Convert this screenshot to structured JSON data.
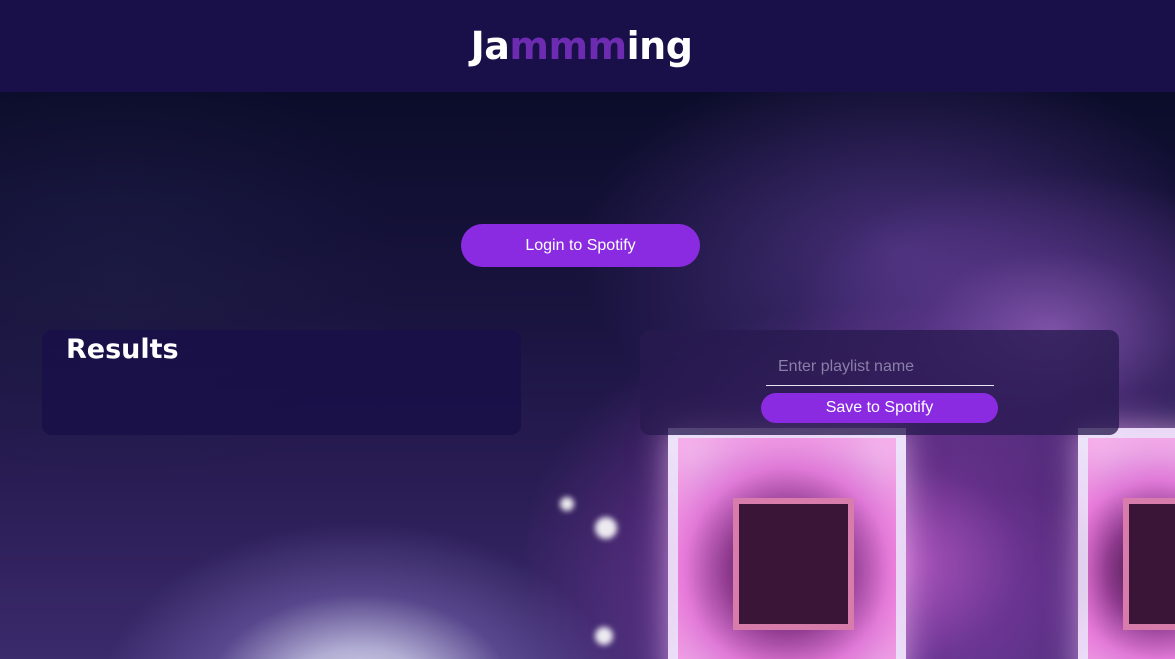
{
  "header": {
    "logo_prefix": "Ja",
    "logo_accent": "mmm",
    "logo_suffix": "ing"
  },
  "auth": {
    "login_label": "Login to Spotify"
  },
  "results": {
    "title": "Results"
  },
  "playlist": {
    "name_value": "",
    "name_placeholder": "Enter playlist name",
    "save_label": "Save to Spotify"
  },
  "colors": {
    "header_bg": "#1a1049",
    "accent": "#6c2bb0",
    "button": "#8a2be2",
    "text": "#ffffff"
  }
}
